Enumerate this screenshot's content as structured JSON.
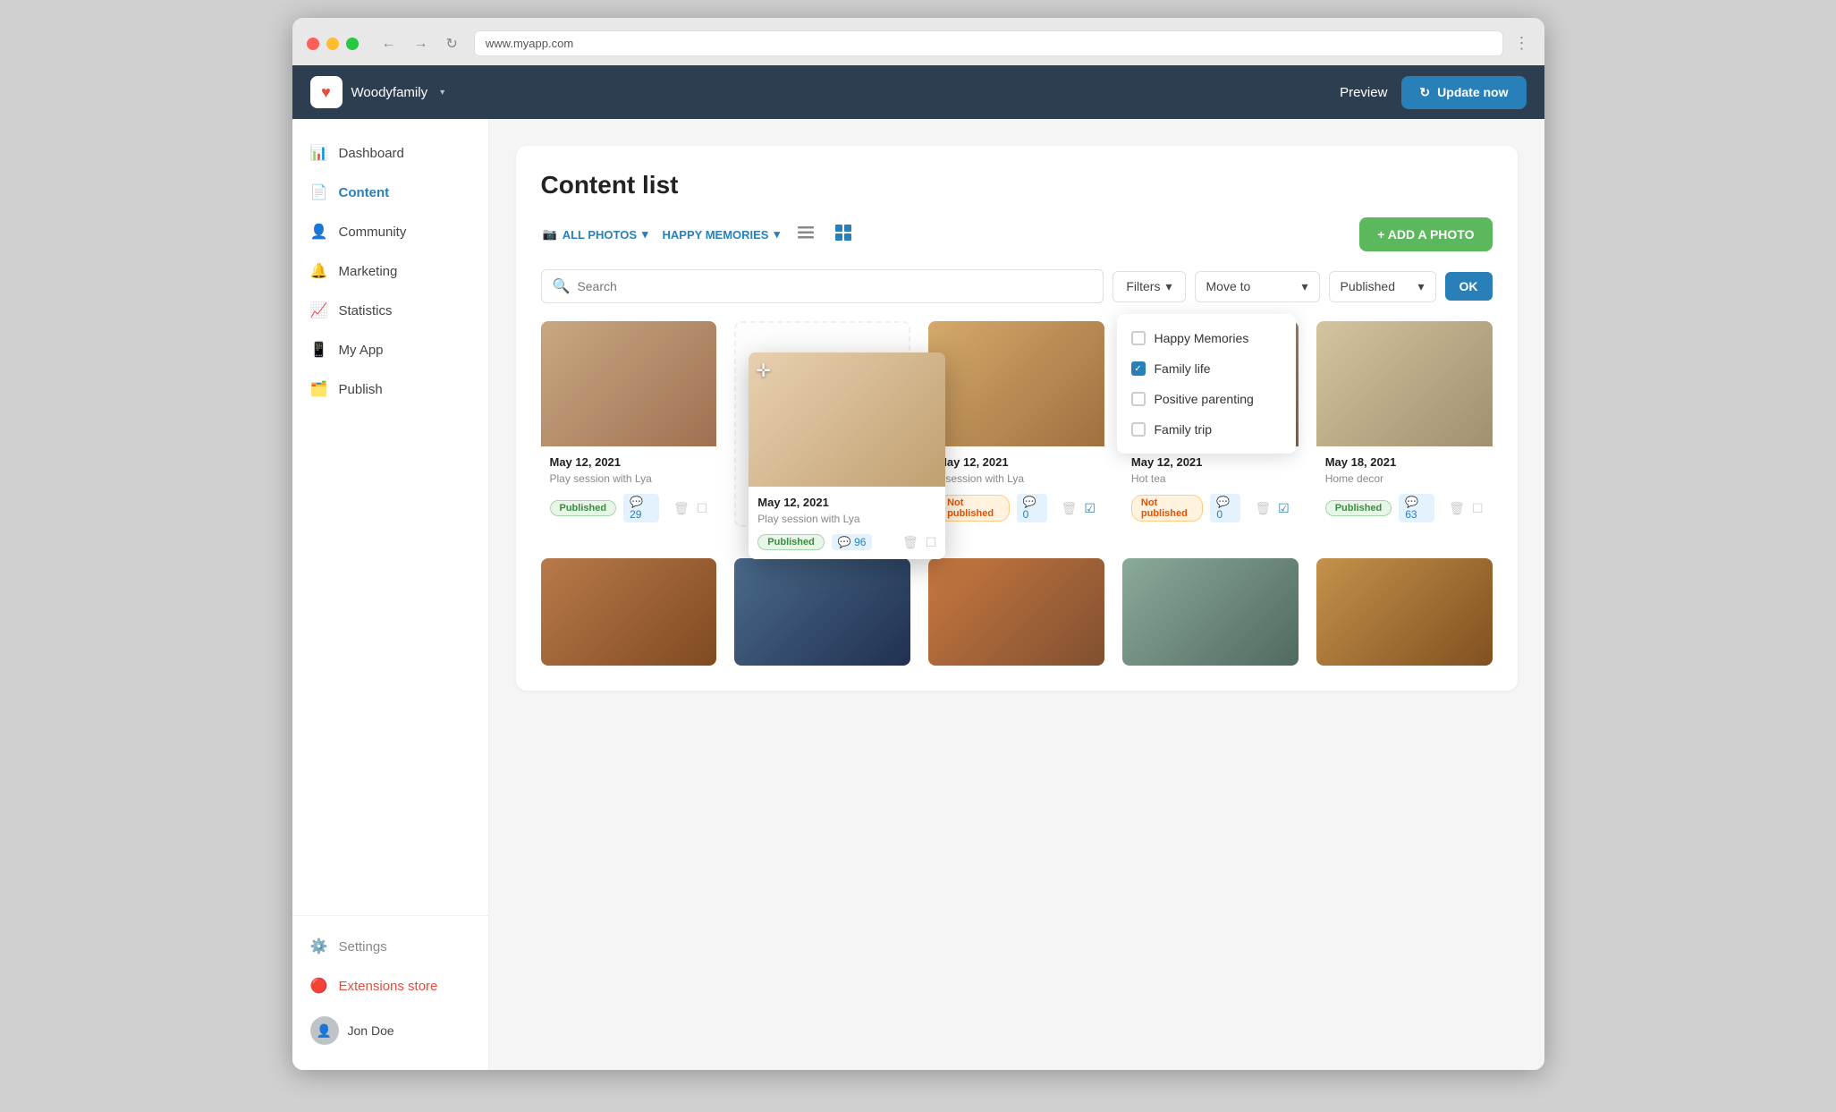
{
  "browser": {
    "url": "www.myapp.com"
  },
  "topbar": {
    "brand_name": "Woodyfamily",
    "brand_arrow": "▾",
    "preview_label": "Preview",
    "update_label": "Update now",
    "update_icon": "↻"
  },
  "sidebar": {
    "items": [
      {
        "id": "dashboard",
        "label": "Dashboard",
        "icon": "📊"
      },
      {
        "id": "content",
        "label": "Content",
        "icon": "📄",
        "active": true
      },
      {
        "id": "community",
        "label": "Community",
        "icon": "👤"
      },
      {
        "id": "marketing",
        "label": "Marketing",
        "icon": "🔔"
      },
      {
        "id": "statistics",
        "label": "Statistics",
        "icon": "📈"
      },
      {
        "id": "myapp",
        "label": "My App",
        "icon": "📱"
      },
      {
        "id": "publish",
        "label": "Publish",
        "icon": "🗂️"
      }
    ],
    "bottom": [
      {
        "id": "settings",
        "label": "Settings",
        "icon": "⚙️"
      },
      {
        "id": "extensions",
        "label": "Extensions store",
        "icon": "🔴"
      }
    ],
    "user": {
      "name": "Jon Doe"
    }
  },
  "page": {
    "title": "Content list"
  },
  "toolbar": {
    "all_photos_label": "ALL PHOTOS",
    "happy_memories_label": "HAPPY MEMORIES",
    "add_photo_label": "+ ADD A PHOTO"
  },
  "filter_row": {
    "search_placeholder": "Search",
    "filters_label": "Filters",
    "move_to_label": "Move to",
    "published_label": "Published",
    "ok_label": "OK"
  },
  "dropdown": {
    "items": [
      {
        "id": "happy_memories",
        "label": "Happy Memories",
        "checked": false
      },
      {
        "id": "family_life",
        "label": "Family life",
        "checked": true
      },
      {
        "id": "positive_parenting",
        "label": "Positive parenting",
        "checked": false
      },
      {
        "id": "family_trip",
        "label": "Family trip",
        "checked": false
      }
    ]
  },
  "photos_row1": [
    {
      "id": "p1",
      "date": "May 12, 2021",
      "caption": "Play session with Lya",
      "status": "Published",
      "comments": 29,
      "bg": "#c8a882"
    },
    {
      "id": "p2",
      "date": "May 12, 2021",
      "caption": "Play session with Lya",
      "status": "Published",
      "comments": 96,
      "bg": "#e8d5c0",
      "dragging": true,
      "floating": true
    },
    {
      "id": "p3",
      "date": "May 12, 2021",
      "caption": "y session with Lya",
      "status": "Not published",
      "comments": 0,
      "bg": "#d4a96a"
    },
    {
      "id": "p4",
      "date": "May 12, 2021",
      "caption": "Hot tea",
      "status": "Not published",
      "comments": 0,
      "bg": "#c4a88a"
    },
    {
      "id": "p5",
      "date": "May 18, 2021",
      "caption": "Home decor",
      "status": "Published",
      "comments": 63,
      "bg": "#d4c4a0"
    }
  ],
  "photos_row2": [
    {
      "id": "r2p1",
      "bg": "#b87a4a"
    },
    {
      "id": "r2p2",
      "bg": "#4a6a8a"
    },
    {
      "id": "r2p3",
      "bg": "#a86a3a"
    },
    {
      "id": "r2p4",
      "bg": "#8aaa9a"
    },
    {
      "id": "r2p5",
      "bg": "#c4924a"
    }
  ],
  "colors": {
    "accent_blue": "#2980b9",
    "sidebar_bg": "#2c3e50",
    "green_btn": "#5cb85c"
  }
}
